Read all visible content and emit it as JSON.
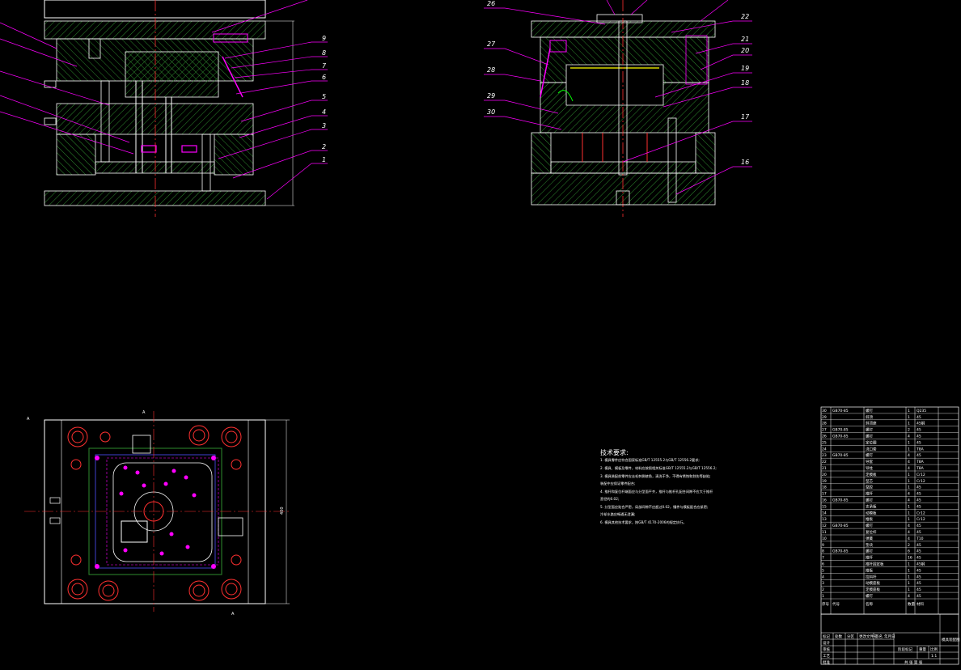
{
  "left_section": {
    "labels": [
      "9",
      "8",
      "7",
      "6",
      "5",
      "4",
      "3",
      "2",
      "1"
    ]
  },
  "right_section": {
    "labels_left": [
      "26",
      "27",
      "28",
      "29",
      "30"
    ],
    "labels_right": [
      "22",
      "21",
      "20",
      "19",
      "18",
      "17",
      "16"
    ]
  },
  "plan_view": {
    "dim_vertical": "400",
    "marker_a_top": "A",
    "marker_a_side": "A",
    "marker_a_bottom": "A"
  },
  "technical_notes": {
    "title": "技术要求:",
    "items": [
      "1. 模具零件应符合国家标准GB/T 12555.2与GB/T 12556.2要求;",
      "2. 模具、模板及零件，材料应按照相关标准GB/T 12555.2与GB/T 12556.2;",
      "3. 模具装配前零件应去毛刺倒棱角，清洗干净，不得有锈蚀和划伤等缺陷;",
      "   装配中应保证零件配合;",
      "4. 推杆和复位杆端面应与分型面平齐，推杆与推杆孔配合间隙不应大于推杆",
      "   直径的0.02;",
      "5. 分型面应贴合严密，局部间隙不应超过0.02，镶件与模板配合应紧密;",
      "   冷却水路应畅通无泄漏;",
      "6. 模具其他技术要求，按GB/T 4170-2006的规定执行。"
    ]
  },
  "parts_table": {
    "rows": [
      [
        "30",
        "GB70-85",
        "螺钉",
        "1",
        "Q235"
      ],
      [
        "29",
        "",
        "斜顶",
        "1",
        "45"
      ],
      [
        "28",
        "",
        "斜顶座",
        "1",
        "45钢"
      ],
      [
        "27",
        "GB70-85",
        "螺钉",
        "2",
        "45"
      ],
      [
        "26",
        "GB70-85",
        "螺钉",
        "4",
        "45"
      ],
      [
        "25",
        "",
        "定位圈",
        "1",
        "45"
      ],
      [
        "24",
        "",
        "浇口套",
        "1",
        "T8A"
      ],
      [
        "23",
        "GB70-85",
        "螺钉",
        "4",
        "45"
      ],
      [
        "22",
        "",
        "导套",
        "4",
        "T8A"
      ],
      [
        "21",
        "",
        "导柱",
        "4",
        "T8A"
      ],
      [
        "20",
        "",
        "定模板",
        "1",
        "Cr12"
      ],
      [
        "19",
        "",
        "型芯",
        "1",
        "Cr12"
      ],
      [
        "18",
        "",
        "型腔",
        "1",
        "45"
      ],
      [
        "17",
        "",
        "推杆",
        "4",
        "45"
      ],
      [
        "16",
        "GB70-85",
        "螺钉",
        "4",
        "45"
      ],
      [
        "15",
        "",
        "支承板",
        "1",
        "45"
      ],
      [
        "14",
        "",
        "动模板",
        "1",
        "Cr12"
      ],
      [
        "13",
        "",
        "推板",
        "1",
        "Cr12"
      ],
      [
        "12",
        "GB70-85",
        "螺钉",
        "4",
        "45"
      ],
      [
        "11",
        "",
        "复位杆",
        "4",
        "45"
      ],
      [
        "10",
        "",
        "弹簧",
        "4",
        "T10"
      ],
      [
        "9",
        "",
        "垫块",
        "2",
        "45"
      ],
      [
        "8",
        "GB70-85",
        "螺钉",
        "6",
        "45"
      ],
      [
        "7",
        "",
        "推杆",
        "16",
        "45"
      ],
      [
        "6",
        "",
        "推杆固定板",
        "1",
        "45钢"
      ],
      [
        "5",
        "",
        "推板",
        "1",
        "45"
      ],
      [
        "4",
        "",
        "拉料杆",
        "1",
        "45"
      ],
      [
        "3",
        "",
        "动模座板",
        "1",
        "45"
      ],
      [
        "2",
        "",
        "定模座板",
        "1",
        "45"
      ],
      [
        "1",
        "",
        "螺钉",
        "4",
        "45"
      ]
    ],
    "header": [
      "序号",
      "代号",
      "名称",
      "数量",
      "材料"
    ],
    "title_block": {
      "c1": "标记",
      "c2": "处数",
      "c3": "分区",
      "c4": "更改文件号",
      "c5": "签名",
      "c6": "年月日",
      "design": "设计",
      "check": "审核",
      "process": "工艺",
      "approve": "批准",
      "stage": "阶段标记",
      "weight": "重量",
      "scale": "比例",
      "scale_val": "1:1",
      "sheet": "共 张  第 张",
      "drawing_name": "模具装配图"
    }
  }
}
